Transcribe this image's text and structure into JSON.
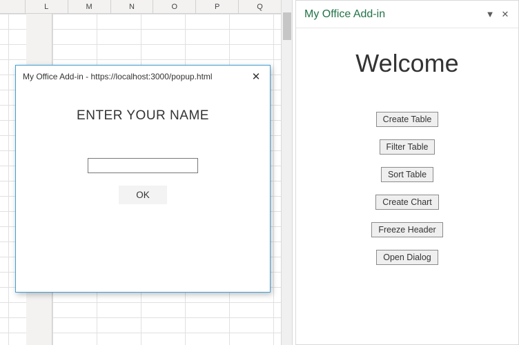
{
  "sheet": {
    "columns": [
      "L",
      "M",
      "N",
      "O",
      "P",
      "Q"
    ]
  },
  "pane": {
    "title": "My Office Add-in",
    "welcome": "Welcome",
    "buttons": {
      "create_table": "Create Table",
      "filter_table": "Filter Table",
      "sort_table": "Sort Table",
      "create_chart": "Create Chart",
      "freeze_header": "Freeze Header",
      "open_dialog": "Open Dialog"
    }
  },
  "popup": {
    "title": "My Office Add-in - https://localhost:3000/popup.html",
    "prompt": "ENTER YOUR NAME",
    "input_value": "",
    "ok_label": "OK",
    "close_glyph": "✕"
  },
  "glyphs": {
    "dropdown": "▼",
    "close": "✕"
  }
}
